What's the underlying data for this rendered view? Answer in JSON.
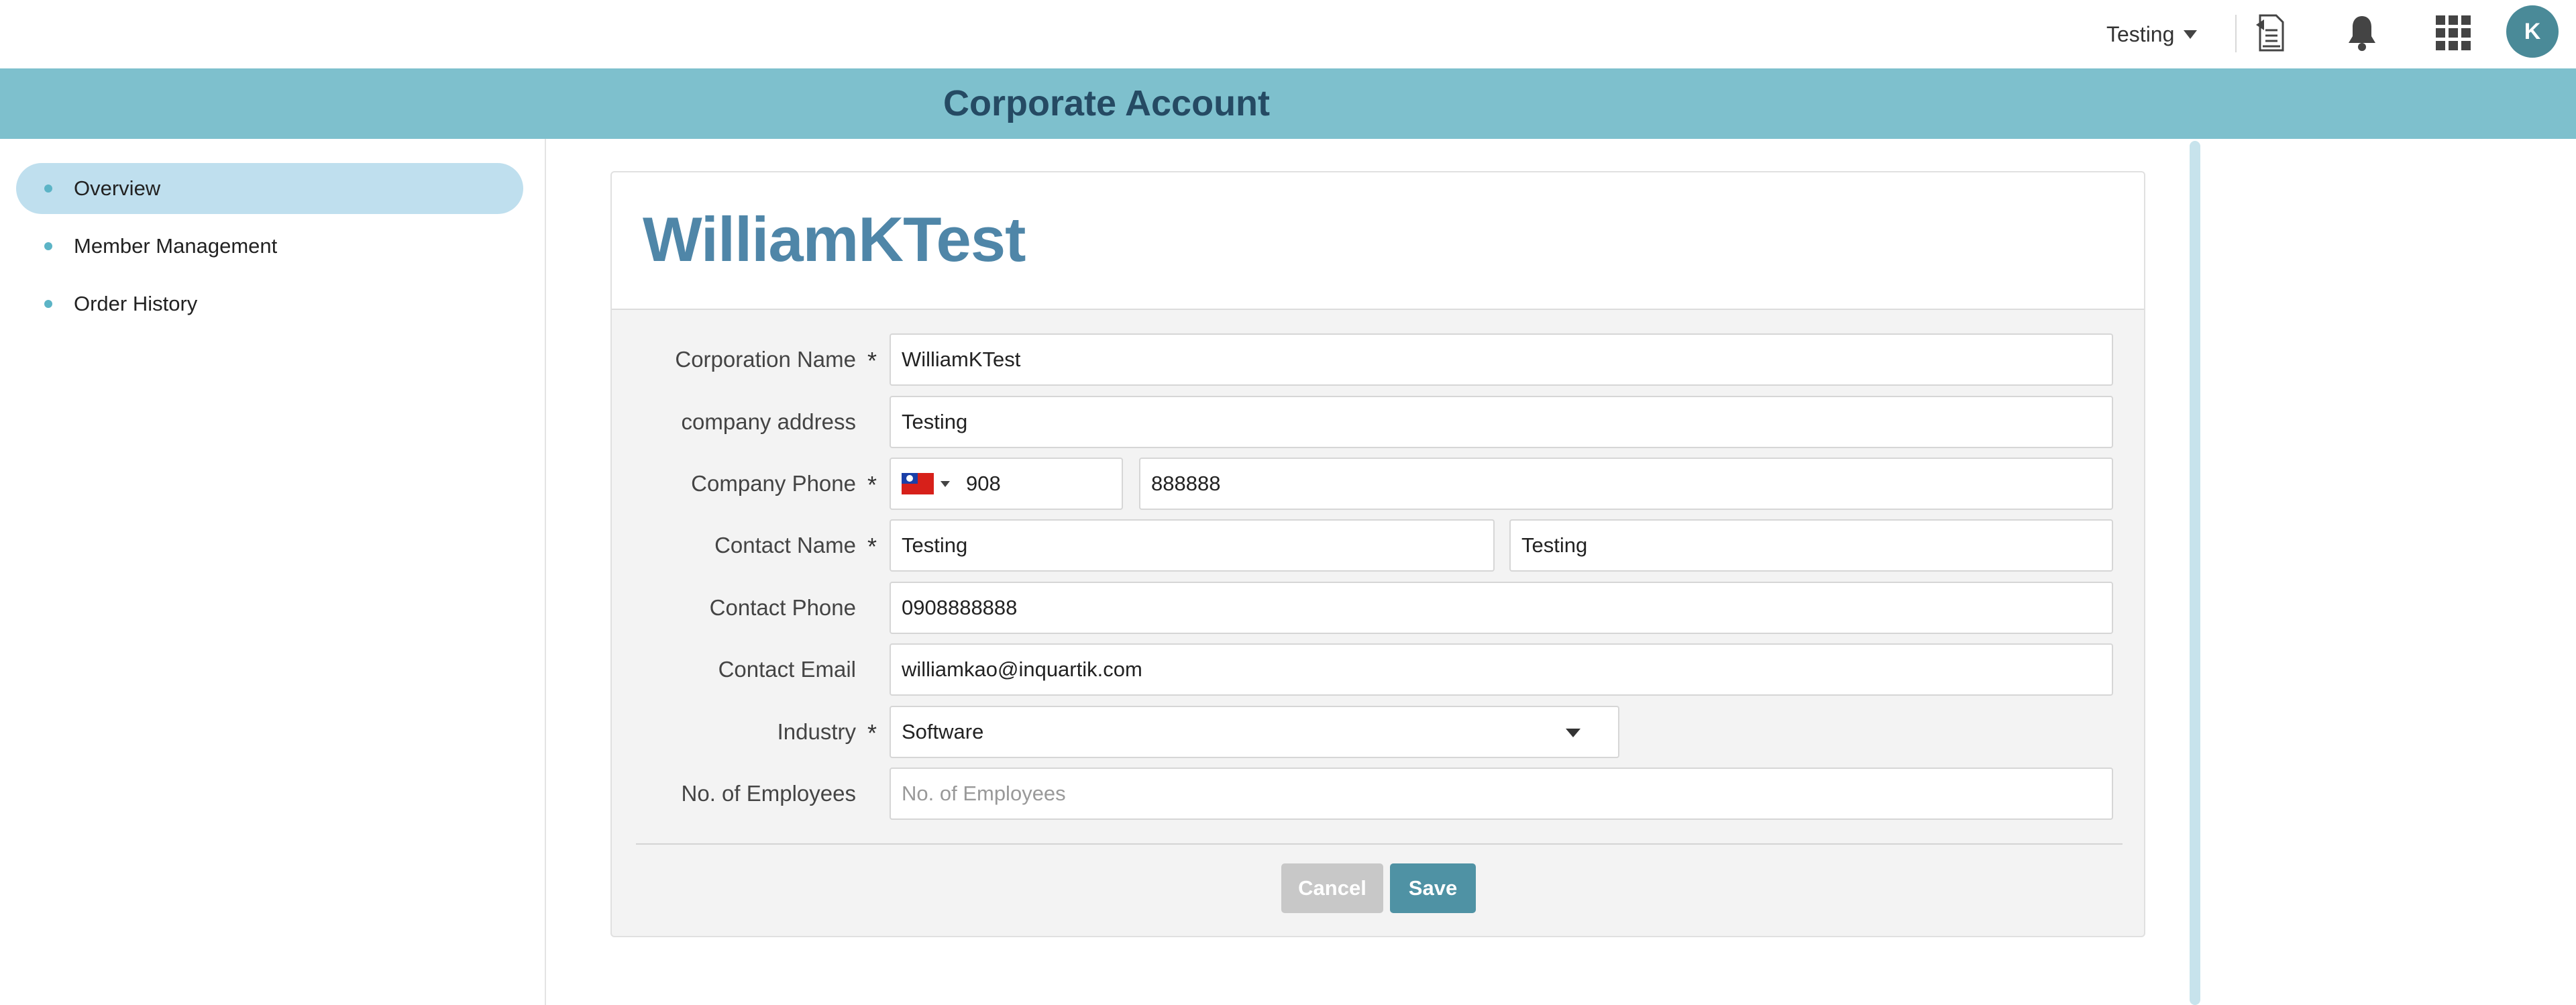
{
  "topbar": {
    "workspace": "Testing",
    "avatar_initial": "K",
    "icons": [
      "document-icon",
      "bell-icon",
      "apps-grid-icon"
    ]
  },
  "header": {
    "title": "Corporate Account"
  },
  "sidebar": {
    "items": [
      {
        "label": "Overview",
        "active": true
      },
      {
        "label": "Member Management",
        "active": false
      },
      {
        "label": "Order History",
        "active": false
      }
    ]
  },
  "corporation": {
    "name_title": "WilliamKTest",
    "fields": {
      "corporation_name": {
        "label": "Corporation Name",
        "required": "*",
        "value": "WilliamKTest"
      },
      "company_address": {
        "label": "company address",
        "value": "Testing"
      },
      "company_phone": {
        "label": "Company Phone",
        "required": "*",
        "country_code": "908",
        "number": "888888"
      },
      "contact_name": {
        "label": "Contact Name",
        "required": "*",
        "first": "Testing",
        "last": "Testing"
      },
      "contact_phone": {
        "label": "Contact Phone",
        "value": "0908888888"
      },
      "contact_email": {
        "label": "Contact Email",
        "value": "williamkao@inquartik.com"
      },
      "industry": {
        "label": "Industry",
        "required": "*",
        "value": "Software"
      },
      "employees": {
        "label": "No. of Employees",
        "placeholder": "No. of Employees"
      }
    },
    "buttons": {
      "cancel": "Cancel",
      "save": "Save"
    }
  },
  "colors": {
    "band": "#7ec0cd",
    "title": "#4f86a8",
    "accent": "#4f92a4",
    "active_nav": "#bfdfee"
  }
}
